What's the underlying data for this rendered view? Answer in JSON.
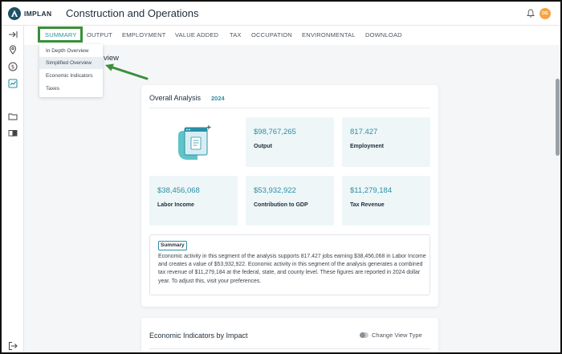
{
  "header": {
    "logo_text": "IMPLAN",
    "title": "Construction and Operations",
    "avatar_initials": "DE",
    "avatar_color": "#f5a445"
  },
  "rail": {
    "icons": [
      "expand-arrow-icon",
      "location-pin-icon",
      "dollar-icon",
      "chart-icon",
      "folder-icon",
      "book-icon",
      "logout-icon"
    ]
  },
  "tabs": [
    {
      "label": "SUMMARY",
      "active": true
    },
    {
      "label": "OUTPUT"
    },
    {
      "label": "EMPLOYMENT"
    },
    {
      "label": "VALUE ADDED"
    },
    {
      "label": "TAX"
    },
    {
      "label": "OCCUPATION"
    },
    {
      "label": "ENVIRONMENTAL"
    },
    {
      "label": "DOWNLOAD"
    }
  ],
  "dropdown": {
    "items": [
      "In Depth Overview",
      "Simplified Overview",
      "Economic Indicators",
      "Taxes"
    ],
    "selected_index": 1
  },
  "obscured_heading_fragment": "view",
  "overall": {
    "title": "Overall Analysis",
    "year": "2024",
    "tiles": [
      {
        "value": "$98,767,265",
        "label": "Output"
      },
      {
        "value": "817.427",
        "label": "Employment"
      },
      {
        "value": "$38,456,068",
        "label": "Labor Income"
      },
      {
        "value": "$53,932,922",
        "label": "Contribution to GDP"
      },
      {
        "value": "$11,279,184",
        "label": "Tax Revenue"
      }
    ],
    "summary_tag": "Summary",
    "summary_text": "Economic activity in this segment of the analysis supports 817.427 jobs earning $38,456,068 in Labor Income and creates a value of $53,932,922. Economic activity in this segment of the analysis generates a combined tax revenue of $11,279,184 at the federal, state, and county level. These figures are reported in 2024 dollar year. To adjust this, visit your preferences."
  },
  "indicators": {
    "title": "Economic Indicators by Impact",
    "toggle_label": "Change View Type"
  },
  "colors": {
    "accent": "#2a8fa6",
    "annotation_green": "#3a8f3a",
    "tile_bg": "#eef6f8"
  }
}
